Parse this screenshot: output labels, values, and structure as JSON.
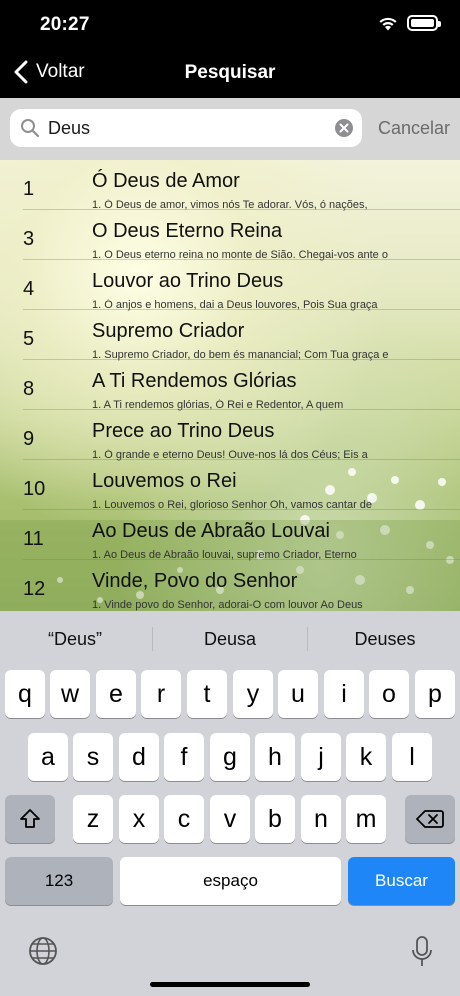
{
  "status_bar": {
    "time": "20:27"
  },
  "nav": {
    "back_label": "Voltar",
    "title": "Pesquisar"
  },
  "search": {
    "value": "Deus",
    "cancel_label": "Cancelar"
  },
  "results": [
    {
      "number": "1",
      "title": "Ó Deus de Amor",
      "snippet": "1. Ó Deus de amor, vimos nós Te adorar. Vós, ó nações,"
    },
    {
      "number": "3",
      "title": "O Deus Eterno Reina",
      "snippet": "1. O Deus eterno reina no monte de Sião. Chegai-vos ante o"
    },
    {
      "number": "4",
      "title": "Louvor ao Trino Deus",
      "snippet": "1. Ó anjos e homens, dai a Deus louvores, Pois Sua graça"
    },
    {
      "number": "5",
      "title": "Supremo Criador",
      "snippet": "1. Supremo Criador, do bem és manancial; Com Tua graça e"
    },
    {
      "number": "8",
      "title": "A Ti Rendemos Glórias",
      "snippet": "1. A Ti rendemos glórias, Ó Rei e Redentor, A quem"
    },
    {
      "number": "9",
      "title": "Prece ao Trino Deus",
      "snippet": "1. Ó grande e eterno Deus! Ouve-nos lá dos Céus; Eis a"
    },
    {
      "number": "10",
      "title": "Louvemos o Rei",
      "snippet": "1. Louvemos o Rei, glorioso Senhor Oh, vamos cantar de"
    },
    {
      "number": "11",
      "title": "Ao Deus de Abraão Louvai",
      "snippet": "1. Ao Deus de Abraão louvai, supremo Criador, Eterno"
    },
    {
      "number": "12",
      "title": "Vinde, Povo do Senhor",
      "snippet": "1. Vinde povo do Senhor, adorai-O com louvor Ao Deus"
    }
  ],
  "keyboard": {
    "suggestions": [
      "“Deus”",
      "Deusa",
      "Deuses"
    ],
    "row1": [
      "q",
      "w",
      "e",
      "r",
      "t",
      "y",
      "u",
      "i",
      "o",
      "p"
    ],
    "row2": [
      "a",
      "s",
      "d",
      "f",
      "g",
      "h",
      "j",
      "k",
      "l"
    ],
    "row3": [
      "z",
      "x",
      "c",
      "v",
      "b",
      "n",
      "m"
    ],
    "numbers_label": "123",
    "space_label": "espaço",
    "return_label": "Buscar"
  }
}
